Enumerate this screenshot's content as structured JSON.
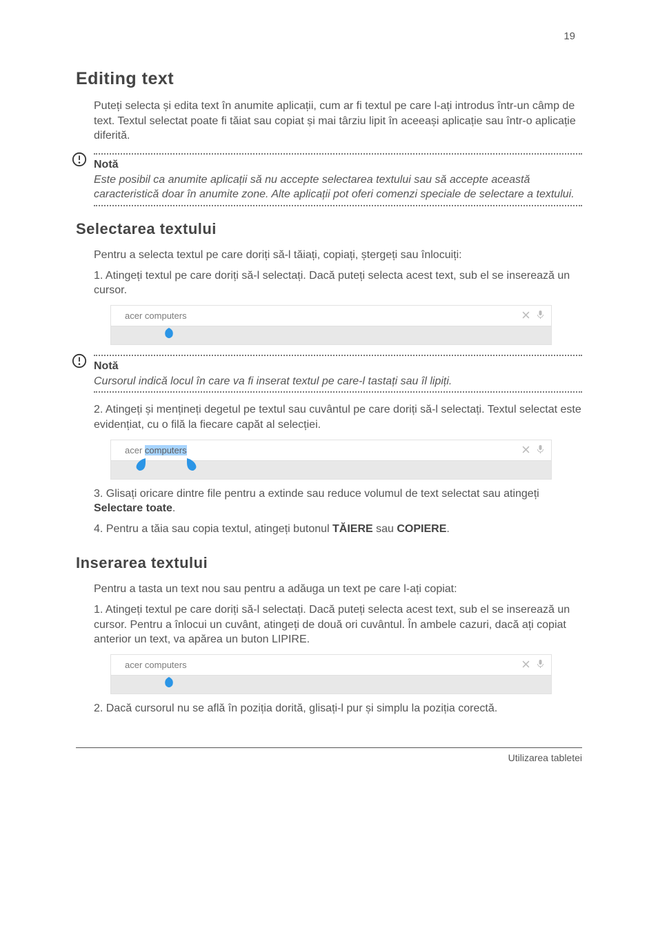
{
  "page_number": "19",
  "heading": "Editing text",
  "para1": "Puteți selecta și edita text în anumite aplicații, cum ar fi textul pe care l-ați introdus într-un câmp de text. Textul selectat poate fi tăiat sau copiat și mai târziu lipit în aceeași aplicație sau într-o aplicație diferită.",
  "note1": {
    "label": "Notă",
    "text": "Este posibil ca anumite aplicații să nu accepte selectarea textului sau să accepte această caracteristică doar în anumite zone. Alte aplicații pot oferi comenzi speciale de selectare a textului."
  },
  "subhead1": "Selectarea textului",
  "para2": "Pentru a selecta textul pe care doriți să-l tăiați, copiați, ștergeți sau înlocuiți:",
  "step1_pre": "1.  Atingeți textul pe care doriți să-l selectați. Dacă puteți selecta acest text, sub el se inserează un cursor.",
  "note2": {
    "label": "Notă",
    "text": "Cursorul indică locul în care va fi inserat textul pe care-l tastați sau îl lipiți."
  },
  "searchbox": {
    "text_before": "acer ",
    "text_after": "computers"
  },
  "step2_pre": "2.  Atingeți și mențineți degetul pe textul sau cuvântul pe care doriți să-l selectați. Textul selectat este evidențiat, cu o filă la fiecare capăt al selecției.",
  "step3_pre": "3.  Glisați oricare dintre file pentru a extinde sau reduce volumul de text selectat sau atingeți ",
  "step3_bold": "Selectare toate",
  "step3_post": ".",
  "step4_pre": "4.  Pentru a tăia sau copia textul, atingeți butonul ",
  "step4_bold1": "TĂIERE",
  "step4_mid": " sau ",
  "step4_bold2": "COPIERE",
  "step4_post": ".",
  "subhead2": "Inserarea textului",
  "para3": "Pentru a tasta un text nou sau pentru a adăuga un text pe care l-ați copiat:",
  "step_ins1": "1.  Atingeți textul pe care doriți să-l selectați. Dacă puteți selecta acest text, sub el se inserează un cursor. Pentru a înlocui un cuvânt, atingeți de două ori cuvântul. În ambele cazuri, dacă ați copiat anterior un text, va apărea un buton LIPIRE.",
  "step_ins2_pre": "2.  Dacă cursorul nu se află în poziția dorită, glisați-l pur și simplu la poziția corectă.",
  "footer": "Utilizarea tabletei"
}
